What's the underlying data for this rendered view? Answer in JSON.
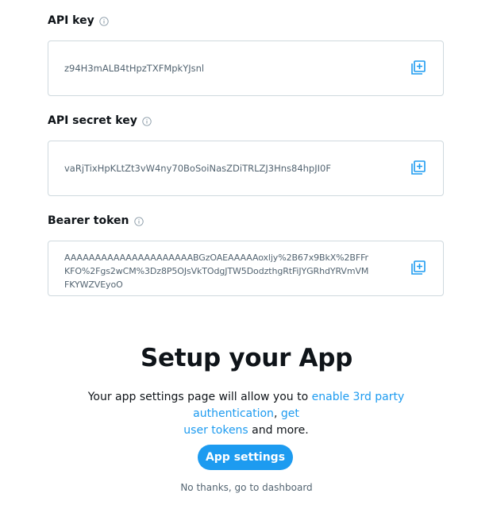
{
  "keys": {
    "api_key": {
      "label": "API key",
      "value": "z94H3mALB4tHpzTXFMpkYJsnl"
    },
    "api_secret": {
      "label": "API secret key",
      "value": "vaRjTixHpKLtZt3vW4ny70BoSoiNasZDiTRLZJ3Hns84hpJI0F"
    },
    "bearer": {
      "label": "Bearer token",
      "lines": [
        "AAAAAAAAAAAAAAAAAAAAABGzOAEAAAAAoxljy%2B67x9BkX%2BFFr",
        "KFO%2Fgs2wCM%3Dz8P5OJsVkTOdgJTW5DodzthgRtFiJYGRhdYRVmVM",
        "FKYWZVEyoO"
      ]
    }
  },
  "setup": {
    "title": "Setup your App",
    "desc_prefix": "Your app settings page will allow you to ",
    "link_3rd_party": "enable 3rd party authentication",
    "desc_comma": ", ",
    "link_user_tokens_1": "get",
    "link_user_tokens_2": "user tokens",
    "desc_suffix": " and more.",
    "button_label": "App settings",
    "dashboard_link": "No thanks, go to dashboard"
  },
  "colors": {
    "accent": "#1d9bf0",
    "text": "#0f1419",
    "muted": "#536471",
    "border": "#cfd9de"
  },
  "icons": {
    "info": "info-icon",
    "copy": "copy-icon"
  }
}
